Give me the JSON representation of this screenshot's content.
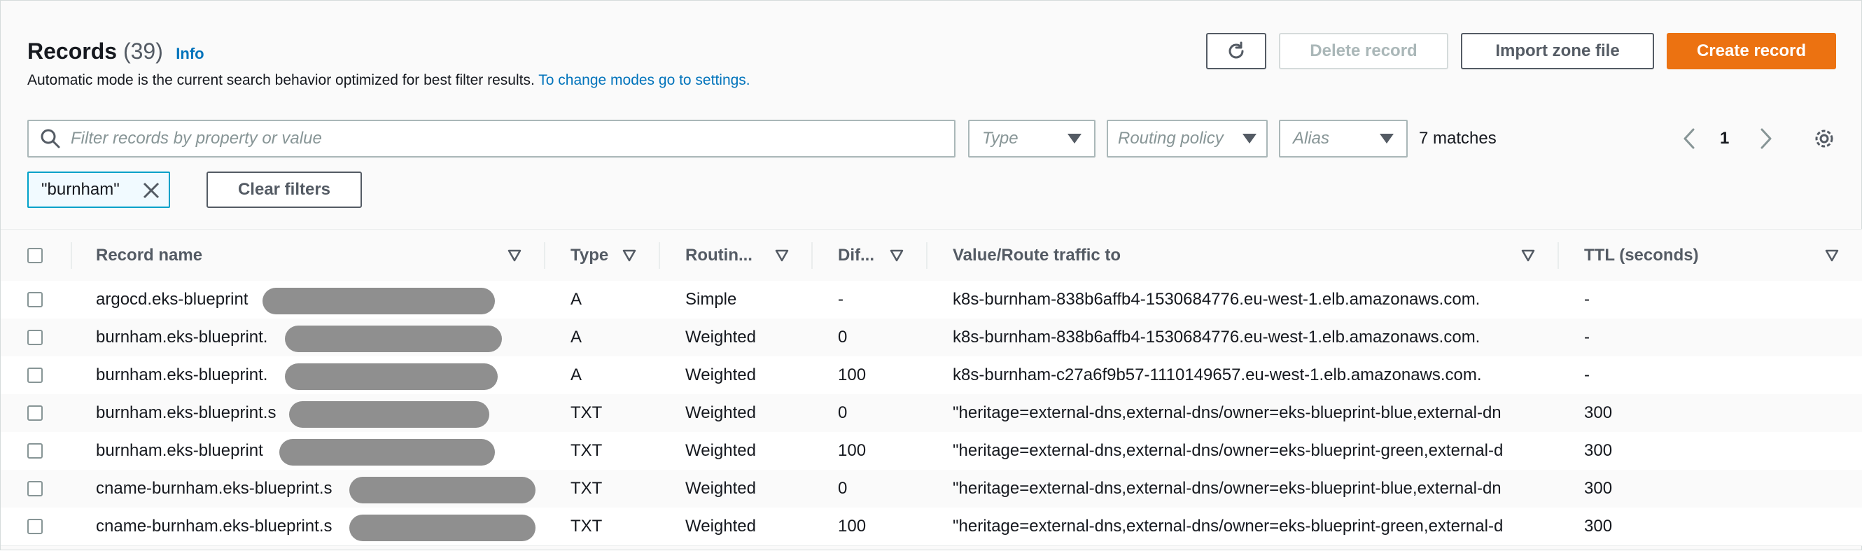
{
  "header": {
    "title": "Records",
    "count": "(39)",
    "info_label": "Info",
    "description": "Automatic mode is the current search behavior optimized for best filter results. ",
    "description_link": "To change modes go to settings."
  },
  "toolbar": {
    "refresh_icon": "refresh-icon",
    "delete_label": "Delete record",
    "import_label": "Import zone file",
    "create_label": "Create record"
  },
  "filters": {
    "search_placeholder": "Filter records by property or value",
    "type_placeholder": "Type",
    "routing_placeholder": "Routing policy",
    "alias_placeholder": "Alias",
    "matches": "7 matches",
    "page": "1",
    "token_label": "\"burnham\"",
    "clear_label": "Clear filters"
  },
  "table": {
    "columns": [
      "Record name",
      "Type",
      "Routin...",
      "Dif...",
      "Value/Route traffic to",
      "TTL (seconds)"
    ],
    "rows": [
      {
        "name": "argocd.eks-blueprint",
        "type": "A",
        "routing": "Simple",
        "diff": "-",
        "value": "k8s-burnham-838b6affb4-1530684776.eu-west-1.elb.amazonaws.com.",
        "ttl": "-"
      },
      {
        "name": "burnham.eks-blueprint.",
        "type": "A",
        "routing": "Weighted",
        "diff": "0",
        "value": "k8s-burnham-838b6affb4-1530684776.eu-west-1.elb.amazonaws.com.",
        "ttl": "-"
      },
      {
        "name": "burnham.eks-blueprint.",
        "type": "A",
        "routing": "Weighted",
        "diff": "100",
        "value": "k8s-burnham-c27a6f9b57-1110149657.eu-west-1.elb.amazonaws.com.",
        "ttl": "-"
      },
      {
        "name": "burnham.eks-blueprint.s",
        "type": "TXT",
        "routing": "Weighted",
        "diff": "0",
        "value": "\"heritage=external-dns,external-dns/owner=eks-blueprint-blue,external-dn",
        "ttl": "300"
      },
      {
        "name": "burnham.eks-blueprint",
        "type": "TXT",
        "routing": "Weighted",
        "diff": "100",
        "value": "\"heritage=external-dns,external-dns/owner=eks-blueprint-green,external-d",
        "ttl": "300"
      },
      {
        "name": "cname-burnham.eks-blueprint.s",
        "type": "TXT",
        "routing": "Weighted",
        "diff": "0",
        "value": "\"heritage=external-dns,external-dns/owner=eks-blueprint-blue,external-dn",
        "ttl": "300"
      },
      {
        "name": "cname-burnham.eks-blueprint.s",
        "type": "TXT",
        "routing": "Weighted",
        "diff": "100",
        "value": "\"heritage=external-dns,external-dns/owner=eks-blueprint-green,external-d",
        "ttl": "300"
      }
    ]
  },
  "colors": {
    "accent": "#ec7211",
    "link": "#0073bb",
    "token_border": "#00a1c9"
  }
}
